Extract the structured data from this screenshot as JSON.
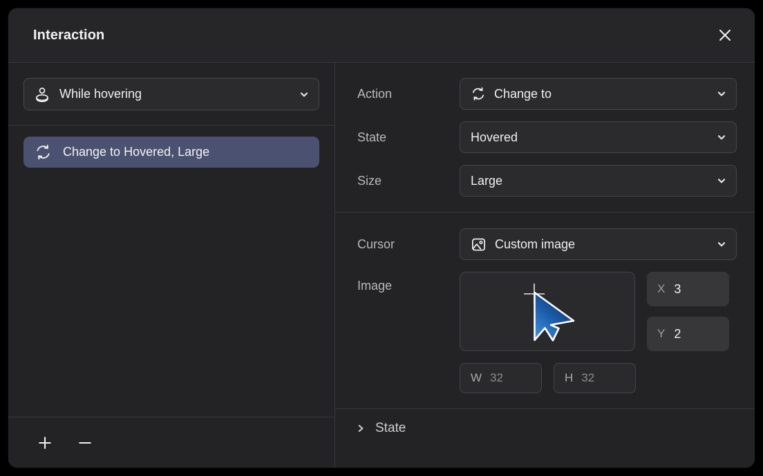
{
  "window": {
    "title": "Interaction",
    "close_icon": "close-icon"
  },
  "left_panel": {
    "trigger": {
      "icon": "hover-pointer-icon",
      "value": "While hovering",
      "chevron": "chevron-down-icon"
    },
    "actions": [
      {
        "icon": "change-to-icon",
        "label": "Change to Hovered, Large",
        "selected": true
      }
    ],
    "toolbar": {
      "add_label": "+",
      "add_icon": "plus-icon",
      "remove_label": "—",
      "remove_icon": "minus-icon"
    }
  },
  "right_panel": {
    "group_behavior": {
      "rows": [
        {
          "label": "Action",
          "value": "Change to",
          "icon": "change-to-icon"
        },
        {
          "label": "State",
          "value": "Hovered",
          "icon": null
        },
        {
          "label": "Size",
          "value": "Large",
          "icon": null
        }
      ]
    },
    "group_cursor": {
      "cursor": {
        "label": "Cursor",
        "value": "Custom image",
        "icon": "image-icon"
      },
      "image": {
        "label": "Image",
        "preview_icon": "blue-arrow-cursor-preview",
        "x": {
          "key": "X",
          "value": "3"
        },
        "y": {
          "key": "Y",
          "value": "2"
        },
        "w": {
          "key": "W",
          "value": "32"
        },
        "h": {
          "key": "H",
          "value": "32"
        }
      }
    },
    "disclosure": {
      "icon": "chevron-right-icon",
      "label": "State"
    }
  },
  "colors": {
    "window_bg": "#232326",
    "titlebar_bg": "#262629",
    "divider": "#38383c",
    "selected_row": "#4b5271",
    "field_bg": "#2b2b2e",
    "field_border": "#46464a",
    "num_field_bg": "#37373a",
    "text_primary": "#f2f2f3",
    "text_label": "#b9b9bb",
    "text_muted": "#8d8d90",
    "cursor_blue": "#1f5fab"
  }
}
